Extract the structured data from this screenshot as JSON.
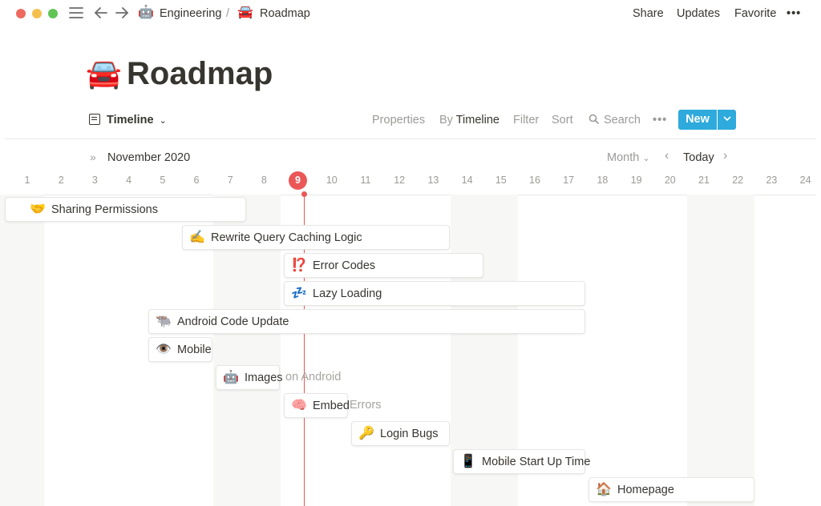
{
  "breadcrumb": {
    "parent_emoji": "🤖",
    "parent_label": "Engineering",
    "separator": "/",
    "current_emoji": "🚘",
    "current_label": "Roadmap"
  },
  "top_actions": {
    "share": "Share",
    "updates": "Updates",
    "favorite": "Favorite",
    "more": "•••"
  },
  "page": {
    "emoji": "🚘",
    "title": "Roadmap"
  },
  "view": {
    "name": "Timeline",
    "properties": "Properties",
    "by_prefix": "By",
    "by_value": "Timeline",
    "filter": "Filter",
    "sort": "Sort",
    "search": "Search",
    "more": "•••",
    "new": "New"
  },
  "timeline": {
    "month": "November 2020",
    "zoom": "Month",
    "today_label": "Today",
    "today_day": "9",
    "days": [
      "1",
      "2",
      "3",
      "4",
      "5",
      "6",
      "7",
      "8",
      "9",
      "10",
      "11",
      "12",
      "13",
      "14",
      "15",
      "16",
      "17",
      "18",
      "19",
      "20",
      "21",
      "22",
      "23",
      "24"
    ]
  },
  "tasks": [
    {
      "emoji": "🤝",
      "label": "Sharing Permissions"
    },
    {
      "emoji": "✍️",
      "label": "Rewrite Query Caching Logic"
    },
    {
      "emoji": "⁉️",
      "label": "Error Codes"
    },
    {
      "emoji": "💤",
      "label": "Lazy Loading"
    },
    {
      "emoji": "🐃",
      "label": "Android Code Update"
    },
    {
      "emoji": "👁️",
      "label": "Mobile"
    },
    {
      "emoji": "🤖",
      "label": "Images",
      "overflow": "on Android"
    },
    {
      "emoji": "🧠",
      "label": "Embed",
      "overflow": "Errors"
    },
    {
      "emoji": "🔑",
      "label": "Login Bugs"
    },
    {
      "emoji": "📱",
      "label": "Mobile Start Up Time"
    },
    {
      "emoji": "🏠",
      "label": "Homepage"
    }
  ],
  "colors": {
    "accent": "#2eaadc",
    "today": "#eb5757",
    "text": "#37352f",
    "muted": "#9b9a97"
  }
}
